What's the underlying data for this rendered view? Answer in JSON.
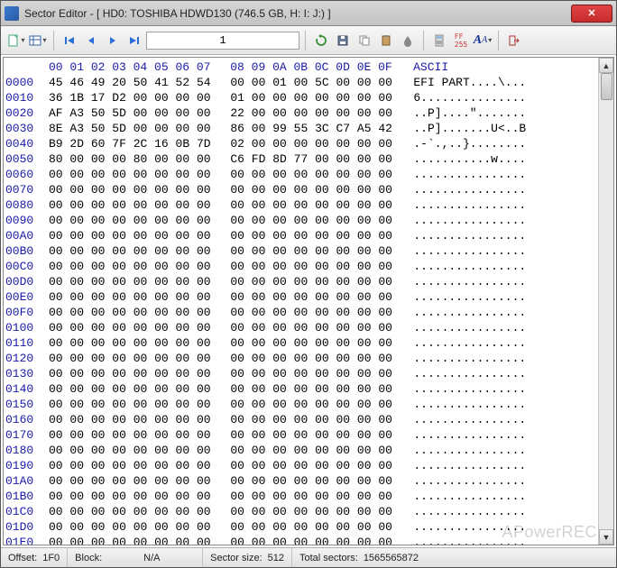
{
  "window": {
    "title": "Sector Editor - [ HD0: TOSHIBA HDWD130 (746.5 GB, H: I: J:) ]"
  },
  "toolbar": {
    "sector_value": "1"
  },
  "hex": {
    "col_header": [
      "00",
      "01",
      "02",
      "03",
      "04",
      "05",
      "06",
      "07",
      "08",
      "09",
      "0A",
      "0B",
      "0C",
      "0D",
      "0E",
      "0F"
    ],
    "ascii_header": "ASCII",
    "rows": [
      {
        "off": "0000",
        "b": [
          "45",
          "46",
          "49",
          "20",
          "50",
          "41",
          "52",
          "54",
          "00",
          "00",
          "01",
          "00",
          "5C",
          "00",
          "00",
          "00"
        ],
        "a": "EFI PART....\\..."
      },
      {
        "off": "0010",
        "b": [
          "36",
          "1B",
          "17",
          "D2",
          "00",
          "00",
          "00",
          "00",
          "01",
          "00",
          "00",
          "00",
          "00",
          "00",
          "00",
          "00"
        ],
        "a": "6..............."
      },
      {
        "off": "0020",
        "b": [
          "AF",
          "A3",
          "50",
          "5D",
          "00",
          "00",
          "00",
          "00",
          "22",
          "00",
          "00",
          "00",
          "00",
          "00",
          "00",
          "00"
        ],
        "a": "..P]....\"......."
      },
      {
        "off": "0030",
        "b": [
          "8E",
          "A3",
          "50",
          "5D",
          "00",
          "00",
          "00",
          "00",
          "86",
          "00",
          "99",
          "55",
          "3C",
          "C7",
          "A5",
          "42"
        ],
        "a": "..P].......U<..B"
      },
      {
        "off": "0040",
        "b": [
          "B9",
          "2D",
          "60",
          "7F",
          "2C",
          "16",
          "0B",
          "7D",
          "02",
          "00",
          "00",
          "00",
          "00",
          "00",
          "00",
          "00"
        ],
        "a": ".-`.,..}........"
      },
      {
        "off": "0050",
        "b": [
          "80",
          "00",
          "00",
          "00",
          "80",
          "00",
          "00",
          "00",
          "C6",
          "FD",
          "8D",
          "77",
          "00",
          "00",
          "00",
          "00"
        ],
        "a": "...........w...."
      },
      {
        "off": "0060",
        "b": [
          "00",
          "00",
          "00",
          "00",
          "00",
          "00",
          "00",
          "00",
          "00",
          "00",
          "00",
          "00",
          "00",
          "00",
          "00",
          "00"
        ],
        "a": "................"
      },
      {
        "off": "0070",
        "b": [
          "00",
          "00",
          "00",
          "00",
          "00",
          "00",
          "00",
          "00",
          "00",
          "00",
          "00",
          "00",
          "00",
          "00",
          "00",
          "00"
        ],
        "a": "................"
      },
      {
        "off": "0080",
        "b": [
          "00",
          "00",
          "00",
          "00",
          "00",
          "00",
          "00",
          "00",
          "00",
          "00",
          "00",
          "00",
          "00",
          "00",
          "00",
          "00"
        ],
        "a": "................"
      },
      {
        "off": "0090",
        "b": [
          "00",
          "00",
          "00",
          "00",
          "00",
          "00",
          "00",
          "00",
          "00",
          "00",
          "00",
          "00",
          "00",
          "00",
          "00",
          "00"
        ],
        "a": "................"
      },
      {
        "off": "00A0",
        "b": [
          "00",
          "00",
          "00",
          "00",
          "00",
          "00",
          "00",
          "00",
          "00",
          "00",
          "00",
          "00",
          "00",
          "00",
          "00",
          "00"
        ],
        "a": "................"
      },
      {
        "off": "00B0",
        "b": [
          "00",
          "00",
          "00",
          "00",
          "00",
          "00",
          "00",
          "00",
          "00",
          "00",
          "00",
          "00",
          "00",
          "00",
          "00",
          "00"
        ],
        "a": "................"
      },
      {
        "off": "00C0",
        "b": [
          "00",
          "00",
          "00",
          "00",
          "00",
          "00",
          "00",
          "00",
          "00",
          "00",
          "00",
          "00",
          "00",
          "00",
          "00",
          "00"
        ],
        "a": "................"
      },
      {
        "off": "00D0",
        "b": [
          "00",
          "00",
          "00",
          "00",
          "00",
          "00",
          "00",
          "00",
          "00",
          "00",
          "00",
          "00",
          "00",
          "00",
          "00",
          "00"
        ],
        "a": "................"
      },
      {
        "off": "00E0",
        "b": [
          "00",
          "00",
          "00",
          "00",
          "00",
          "00",
          "00",
          "00",
          "00",
          "00",
          "00",
          "00",
          "00",
          "00",
          "00",
          "00"
        ],
        "a": "................"
      },
      {
        "off": "00F0",
        "b": [
          "00",
          "00",
          "00",
          "00",
          "00",
          "00",
          "00",
          "00",
          "00",
          "00",
          "00",
          "00",
          "00",
          "00",
          "00",
          "00"
        ],
        "a": "................"
      },
      {
        "off": "0100",
        "b": [
          "00",
          "00",
          "00",
          "00",
          "00",
          "00",
          "00",
          "00",
          "00",
          "00",
          "00",
          "00",
          "00",
          "00",
          "00",
          "00"
        ],
        "a": "................"
      },
      {
        "off": "0110",
        "b": [
          "00",
          "00",
          "00",
          "00",
          "00",
          "00",
          "00",
          "00",
          "00",
          "00",
          "00",
          "00",
          "00",
          "00",
          "00",
          "00"
        ],
        "a": "................"
      },
      {
        "off": "0120",
        "b": [
          "00",
          "00",
          "00",
          "00",
          "00",
          "00",
          "00",
          "00",
          "00",
          "00",
          "00",
          "00",
          "00",
          "00",
          "00",
          "00"
        ],
        "a": "................"
      },
      {
        "off": "0130",
        "b": [
          "00",
          "00",
          "00",
          "00",
          "00",
          "00",
          "00",
          "00",
          "00",
          "00",
          "00",
          "00",
          "00",
          "00",
          "00",
          "00"
        ],
        "a": "................"
      },
      {
        "off": "0140",
        "b": [
          "00",
          "00",
          "00",
          "00",
          "00",
          "00",
          "00",
          "00",
          "00",
          "00",
          "00",
          "00",
          "00",
          "00",
          "00",
          "00"
        ],
        "a": "................"
      },
      {
        "off": "0150",
        "b": [
          "00",
          "00",
          "00",
          "00",
          "00",
          "00",
          "00",
          "00",
          "00",
          "00",
          "00",
          "00",
          "00",
          "00",
          "00",
          "00"
        ],
        "a": "................"
      },
      {
        "off": "0160",
        "b": [
          "00",
          "00",
          "00",
          "00",
          "00",
          "00",
          "00",
          "00",
          "00",
          "00",
          "00",
          "00",
          "00",
          "00",
          "00",
          "00"
        ],
        "a": "................"
      },
      {
        "off": "0170",
        "b": [
          "00",
          "00",
          "00",
          "00",
          "00",
          "00",
          "00",
          "00",
          "00",
          "00",
          "00",
          "00",
          "00",
          "00",
          "00",
          "00"
        ],
        "a": "................"
      },
      {
        "off": "0180",
        "b": [
          "00",
          "00",
          "00",
          "00",
          "00",
          "00",
          "00",
          "00",
          "00",
          "00",
          "00",
          "00",
          "00",
          "00",
          "00",
          "00"
        ],
        "a": "................"
      },
      {
        "off": "0190",
        "b": [
          "00",
          "00",
          "00",
          "00",
          "00",
          "00",
          "00",
          "00",
          "00",
          "00",
          "00",
          "00",
          "00",
          "00",
          "00",
          "00"
        ],
        "a": "................"
      },
      {
        "off": "01A0",
        "b": [
          "00",
          "00",
          "00",
          "00",
          "00",
          "00",
          "00",
          "00",
          "00",
          "00",
          "00",
          "00",
          "00",
          "00",
          "00",
          "00"
        ],
        "a": "................"
      },
      {
        "off": "01B0",
        "b": [
          "00",
          "00",
          "00",
          "00",
          "00",
          "00",
          "00",
          "00",
          "00",
          "00",
          "00",
          "00",
          "00",
          "00",
          "00",
          "00"
        ],
        "a": "................"
      },
      {
        "off": "01C0",
        "b": [
          "00",
          "00",
          "00",
          "00",
          "00",
          "00",
          "00",
          "00",
          "00",
          "00",
          "00",
          "00",
          "00",
          "00",
          "00",
          "00"
        ],
        "a": "................"
      },
      {
        "off": "01D0",
        "b": [
          "00",
          "00",
          "00",
          "00",
          "00",
          "00",
          "00",
          "00",
          "00",
          "00",
          "00",
          "00",
          "00",
          "00",
          "00",
          "00"
        ],
        "a": "................"
      },
      {
        "off": "01E0",
        "b": [
          "00",
          "00",
          "00",
          "00",
          "00",
          "00",
          "00",
          "00",
          "00",
          "00",
          "00",
          "00",
          "00",
          "00",
          "00",
          "00"
        ],
        "a": "................"
      },
      {
        "off": "01F0",
        "b": [
          "00",
          "00",
          "00",
          "00",
          "00",
          "00",
          "00",
          "00",
          "00",
          "00",
          "00",
          "00",
          "00",
          "00",
          "00",
          "00"
        ],
        "a": "................"
      }
    ],
    "cursor": {
      "row": 31,
      "col": 0
    }
  },
  "status": {
    "offset_label": "Offset:",
    "offset_value": "1F0",
    "block_label": "Block:",
    "block_value": "N/A",
    "sectorsize_label": "Sector size:",
    "sectorsize_value": "512",
    "totalsectors_label": "Total sectors:",
    "totalsectors_value": "1565565872"
  },
  "watermark": "APowerREC"
}
